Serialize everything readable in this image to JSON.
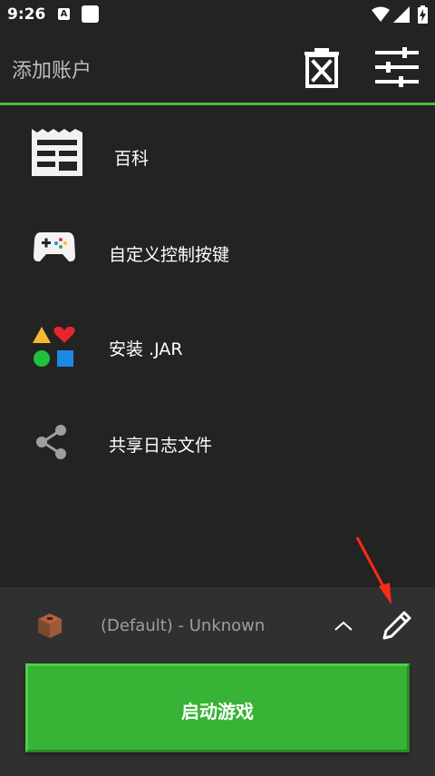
{
  "status_bar": {
    "time": "9:26",
    "notification_icon_label": "A"
  },
  "toolbar": {
    "title": "添加账户"
  },
  "menu": {
    "items": [
      {
        "label": "百科",
        "icon": "wiki-icon"
      },
      {
        "label": "自定义控制按键",
        "icon": "gamepad-icon"
      },
      {
        "label": "安装 .JAR",
        "icon": "shapes-icon"
      },
      {
        "label": "共享日志文件",
        "icon": "share-icon"
      }
    ]
  },
  "bottom": {
    "profile_label": "(Default) - Unknown",
    "launch_label": "启动游戏"
  },
  "colors": {
    "accent": "#4cb944",
    "launch": "#37b335",
    "background": "#232323",
    "bottom_bar": "#303030",
    "annotation": "#ff2a1a"
  }
}
